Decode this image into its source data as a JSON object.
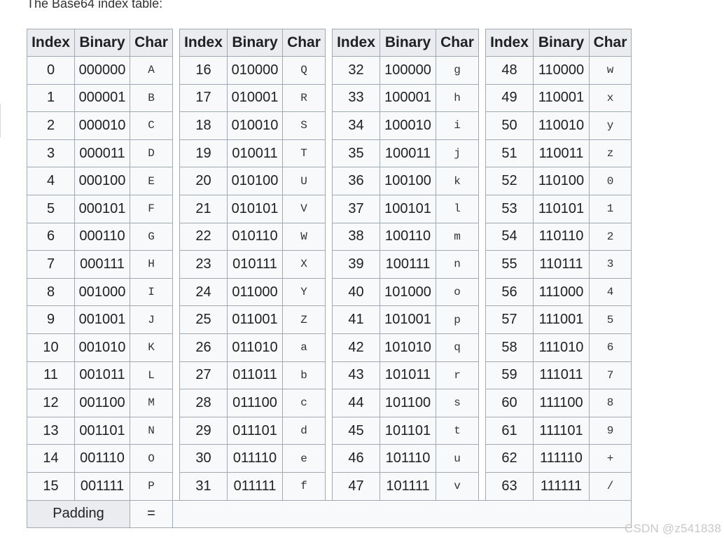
{
  "intro_text": "The Base64 index table:",
  "headers": [
    "Index",
    "Binary",
    "Char"
  ],
  "groups": [
    [
      {
        "index": "0",
        "binary": "000000",
        "char": "A"
      },
      {
        "index": "1",
        "binary": "000001",
        "char": "B"
      },
      {
        "index": "2",
        "binary": "000010",
        "char": "C"
      },
      {
        "index": "3",
        "binary": "000011",
        "char": "D"
      },
      {
        "index": "4",
        "binary": "000100",
        "char": "E"
      },
      {
        "index": "5",
        "binary": "000101",
        "char": "F"
      },
      {
        "index": "6",
        "binary": "000110",
        "char": "G"
      },
      {
        "index": "7",
        "binary": "000111",
        "char": "H"
      },
      {
        "index": "8",
        "binary": "001000",
        "char": "I"
      },
      {
        "index": "9",
        "binary": "001001",
        "char": "J"
      },
      {
        "index": "10",
        "binary": "001010",
        "char": "K"
      },
      {
        "index": "11",
        "binary": "001011",
        "char": "L"
      },
      {
        "index": "12",
        "binary": "001100",
        "char": "M"
      },
      {
        "index": "13",
        "binary": "001101",
        "char": "N"
      },
      {
        "index": "14",
        "binary": "001110",
        "char": "O"
      },
      {
        "index": "15",
        "binary": "001111",
        "char": "P"
      }
    ],
    [
      {
        "index": "16",
        "binary": "010000",
        "char": "Q"
      },
      {
        "index": "17",
        "binary": "010001",
        "char": "R"
      },
      {
        "index": "18",
        "binary": "010010",
        "char": "S"
      },
      {
        "index": "19",
        "binary": "010011",
        "char": "T"
      },
      {
        "index": "20",
        "binary": "010100",
        "char": "U"
      },
      {
        "index": "21",
        "binary": "010101",
        "char": "V"
      },
      {
        "index": "22",
        "binary": "010110",
        "char": "W"
      },
      {
        "index": "23",
        "binary": "010111",
        "char": "X"
      },
      {
        "index": "24",
        "binary": "011000",
        "char": "Y"
      },
      {
        "index": "25",
        "binary": "011001",
        "char": "Z"
      },
      {
        "index": "26",
        "binary": "011010",
        "char": "a"
      },
      {
        "index": "27",
        "binary": "011011",
        "char": "b"
      },
      {
        "index": "28",
        "binary": "011100",
        "char": "c"
      },
      {
        "index": "29",
        "binary": "011101",
        "char": "d"
      },
      {
        "index": "30",
        "binary": "011110",
        "char": "e"
      },
      {
        "index": "31",
        "binary": "011111",
        "char": "f"
      }
    ],
    [
      {
        "index": "32",
        "binary": "100000",
        "char": "g"
      },
      {
        "index": "33",
        "binary": "100001",
        "char": "h"
      },
      {
        "index": "34",
        "binary": "100010",
        "char": "i"
      },
      {
        "index": "35",
        "binary": "100011",
        "char": "j"
      },
      {
        "index": "36",
        "binary": "100100",
        "char": "k"
      },
      {
        "index": "37",
        "binary": "100101",
        "char": "l"
      },
      {
        "index": "38",
        "binary": "100110",
        "char": "m"
      },
      {
        "index": "39",
        "binary": "100111",
        "char": "n"
      },
      {
        "index": "40",
        "binary": "101000",
        "char": "o"
      },
      {
        "index": "41",
        "binary": "101001",
        "char": "p"
      },
      {
        "index": "42",
        "binary": "101010",
        "char": "q"
      },
      {
        "index": "43",
        "binary": "101011",
        "char": "r"
      },
      {
        "index": "44",
        "binary": "101100",
        "char": "s"
      },
      {
        "index": "45",
        "binary": "101101",
        "char": "t"
      },
      {
        "index": "46",
        "binary": "101110",
        "char": "u"
      },
      {
        "index": "47",
        "binary": "101111",
        "char": "v"
      }
    ],
    [
      {
        "index": "48",
        "binary": "110000",
        "char": "w"
      },
      {
        "index": "49",
        "binary": "110001",
        "char": "x"
      },
      {
        "index": "50",
        "binary": "110010",
        "char": "y"
      },
      {
        "index": "51",
        "binary": "110011",
        "char": "z"
      },
      {
        "index": "52",
        "binary": "110100",
        "char": "0"
      },
      {
        "index": "53",
        "binary": "110101",
        "char": "1"
      },
      {
        "index": "54",
        "binary": "110110",
        "char": "2"
      },
      {
        "index": "55",
        "binary": "110111",
        "char": "3"
      },
      {
        "index": "56",
        "binary": "111000",
        "char": "4"
      },
      {
        "index": "57",
        "binary": "111001",
        "char": "5"
      },
      {
        "index": "58",
        "binary": "111010",
        "char": "6"
      },
      {
        "index": "59",
        "binary": "111011",
        "char": "7"
      },
      {
        "index": "60",
        "binary": "111100",
        "char": "8"
      },
      {
        "index": "61",
        "binary": "111101",
        "char": "9"
      },
      {
        "index": "62",
        "binary": "111110",
        "char": "+"
      },
      {
        "index": "63",
        "binary": "111111",
        "char": "/"
      }
    ]
  ],
  "padding": {
    "label": "Padding",
    "char": "="
  },
  "watermark": "CSDN @z541838",
  "colors": {
    "header_bg": "#eaecf0",
    "cell_bg": "#f8f9fa",
    "border": "#a2a9b1"
  }
}
